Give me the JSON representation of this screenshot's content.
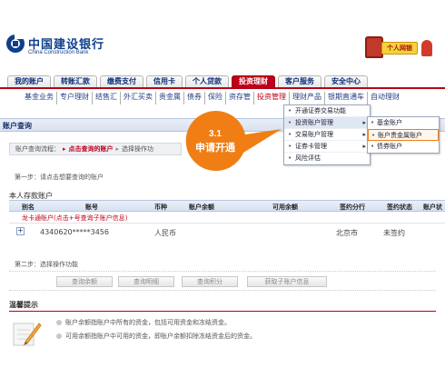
{
  "header": {
    "bank_name": "中国建设银行",
    "bank_name_en": "China Construction Bank",
    "login_badge": "个人网银",
    "brand_color": "#0e3f8c",
    "accent_color": "#c0001a"
  },
  "main_tabs": [
    {
      "label": "我的账户"
    },
    {
      "label": "转账汇款"
    },
    {
      "label": "缴费支付"
    },
    {
      "label": "信用卡"
    },
    {
      "label": "个人贷款"
    },
    {
      "label": "投资理财",
      "active": true
    },
    {
      "label": "客户服务"
    },
    {
      "label": "安全中心"
    }
  ],
  "sub_nav": [
    {
      "label": "基金业务"
    },
    {
      "label": "专户理财"
    },
    {
      "label": "结售汇"
    },
    {
      "label": "外汇买卖"
    },
    {
      "label": "贵金属"
    },
    {
      "label": "债券"
    },
    {
      "label": "保险"
    },
    {
      "label": "资存管"
    },
    {
      "label": "投资管理",
      "active": true
    },
    {
      "label": "理财产品"
    },
    {
      "label": "银期直通车"
    },
    {
      "label": "自动理财"
    }
  ],
  "section": {
    "title": "账户查询"
  },
  "breadcrumb": {
    "step1": "账户查询流程：",
    "current": "点击查询的账户",
    "next": "选择操作功"
  },
  "step1_text": "第一步：请点击想要查询的账户",
  "account_section_label": "本人存款账户",
  "table": {
    "headers": [
      "别名",
      "账号",
      "币种",
      "账户余额",
      "可用余额",
      "签约分行",
      "签约状态",
      "账户状"
    ],
    "group_label": "龙卡通账户(点击+号查询子账户信息)",
    "row": {
      "expand": "+",
      "account": "4340620*****3456",
      "currency": "人民币",
      "branch": "北京市",
      "status": "未签约"
    }
  },
  "step2_text": "第二步：选择操作功能",
  "func_buttons": [
    "查询余额",
    "查询明细",
    "查询积分",
    "获取子账户信息"
  ],
  "tips": {
    "title": "温馨提示",
    "items": [
      "账户余额指账户中所有的资金，包括可用资金和冻结资金。",
      "可用余额指账户中可用的资金，即账户余额扣除冻结资金后的资金。"
    ]
  },
  "menu": {
    "items": [
      {
        "label": "开通证券交易功能",
        "submenu": false
      },
      {
        "label": "投资账户管理",
        "submenu": true,
        "highlight": true
      },
      {
        "label": "交易账户管理",
        "submenu": true
      },
      {
        "label": "证券卡管理",
        "submenu": true
      },
      {
        "label": "风险评估",
        "submenu": false
      }
    ],
    "submenu": [
      {
        "label": "基金账户"
      },
      {
        "label": "账户贵金属账户",
        "highlight": true
      },
      {
        "label": "债券账户"
      }
    ]
  },
  "callout": {
    "number": "3.1",
    "text": "申请开通",
    "color": "#f07e14"
  }
}
